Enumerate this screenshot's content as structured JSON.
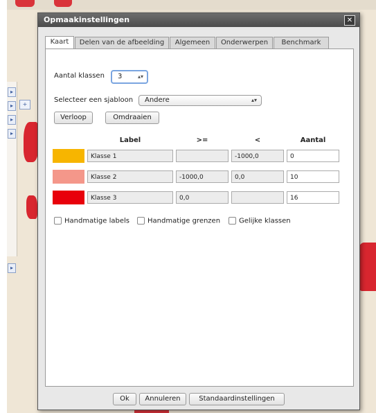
{
  "dialog": {
    "title": "Opmaakinstellingen",
    "close_label": "✕",
    "tabs": [
      {
        "label": "Kaart",
        "active": true
      },
      {
        "label": "Delen van de afbeelding",
        "active": false
      },
      {
        "label": "Algemeen",
        "active": false
      },
      {
        "label": "Onderwerpen",
        "active": false
      },
      {
        "label": "Benchmark",
        "active": false
      }
    ]
  },
  "kaart": {
    "aantal_klassen_label": "Aantal klassen",
    "aantal_klassen_value": "3",
    "select_label": "Selecteer een sjabloon",
    "select_value": "Andere",
    "verloop_button": "Verloop",
    "omdraaien_button": "Omdraaien",
    "headers": {
      "label": "Label",
      "from": ">=",
      "to": "<",
      "count": "Aantal"
    },
    "rows": [
      {
        "color": "#f7b500",
        "label": "Klasse 1",
        "from": "",
        "to": "-1000,0",
        "count": "0"
      },
      {
        "color": "#f4978a",
        "label": "Klasse 2",
        "from": "-1000,0",
        "to": "0,0",
        "count": "10"
      },
      {
        "color": "#e8000b",
        "label": "Klasse 3",
        "from": "0,0",
        "to": "",
        "count": "16"
      }
    ],
    "checkboxes": [
      {
        "label": "Handmatige labels",
        "checked": false
      },
      {
        "label": "Handmatige grenzen",
        "checked": false
      },
      {
        "label": "Gelijke klassen",
        "checked": false
      }
    ]
  },
  "footer": {
    "ok": "Ok",
    "annuleren": "Annuleren",
    "standaard": "Standaardinstellingen"
  },
  "colors": {
    "titlebar": "#5a5a5a",
    "map_background": "#efe6d6",
    "map_region": "#d8262f",
    "focus_border": "#7aa5e0"
  }
}
